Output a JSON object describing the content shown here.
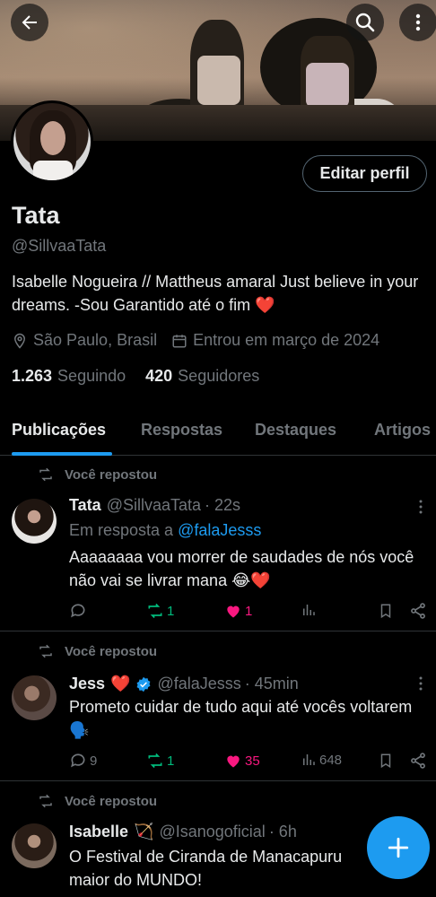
{
  "profile": {
    "name": "Tata",
    "handle": "@SillvaaTata",
    "edit_label": "Editar perfil",
    "bio": "Isabelle Nogueira // Mattheus amaral  Just believe in your dreams.  -Sou Garantido até o fim",
    "bio_emoji": "❤️",
    "location": "São Paulo, Brasil",
    "joined": "Entrou em março de 2024",
    "following_count": "1.263",
    "following_label": "Seguindo",
    "followers_count": "420",
    "followers_label": "Seguidores"
  },
  "tabs": [
    {
      "label": "Publicações",
      "active": true
    },
    {
      "label": "Respostas",
      "active": false
    },
    {
      "label": "Destaques",
      "active": false
    },
    {
      "label": "Artigos",
      "active": false
    }
  ],
  "posts": [
    {
      "repost_label": "Você repostou",
      "name": "Tata",
      "handle": "@SillvaaTata",
      "time": "· 22s",
      "reply_prefix": "Em resposta a",
      "reply_handle": "@falaJesss",
      "text": "Aaaaaaaa vou morrer de saudades de nós você não vai se livrar mana 😂❤️",
      "reposts": "1",
      "likes": "1",
      "views": ""
    },
    {
      "repost_label": "Você repostou",
      "name": "Jess",
      "name_emoji": "❤️",
      "verified": true,
      "handle": "@falaJesss",
      "time": "· 45min",
      "text": "Prometo cuidar de tudo aqui até vocês voltarem 🗣️",
      "replies": "9",
      "reposts": "1",
      "likes": "35",
      "views": "648"
    },
    {
      "repost_label": "Você repostou",
      "name": "Isabelle",
      "name_emoji": "🏹",
      "handle": "@Isanogoficial",
      "time": "· 6h",
      "text": "O Festival de Ciranda de Manacapuru maior do MUNDO!"
    }
  ],
  "colors": {
    "accent": "#1d9bf0",
    "background": "#000000",
    "muted": "#71767b",
    "repost_green": "#00ba7c",
    "like_pink": "#f91880"
  },
  "icons": {
    "back": "arrow-left-icon",
    "search": "search-icon",
    "more": "more-vertical-icon",
    "compose": "plus-icon"
  }
}
